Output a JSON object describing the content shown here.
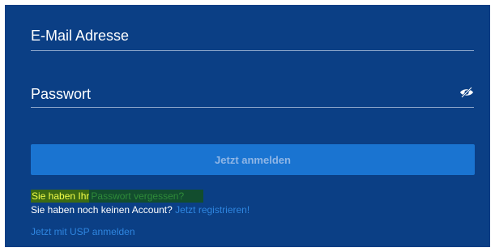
{
  "form": {
    "email_placeholder": "E-Mail Adresse",
    "password_placeholder": "Passwort",
    "submit_label": "Jetzt anmelden"
  },
  "links": {
    "forgot_prefix": "Sie haben Ihr",
    "forgot_link": "Passwort vergessen?",
    "register_prefix": "Sie haben noch keinen Account?",
    "register_link": "Jetzt registrieren!",
    "usp_link": "Jetzt mit USP anmelden"
  },
  "icons": {
    "password_toggle": "eye-slash-icon"
  },
  "colors": {
    "panel_background": "#0b3f85",
    "button_background": "#1a74d1",
    "link_color": "#2f86e0",
    "highlight_text": "#f4ff4a"
  }
}
